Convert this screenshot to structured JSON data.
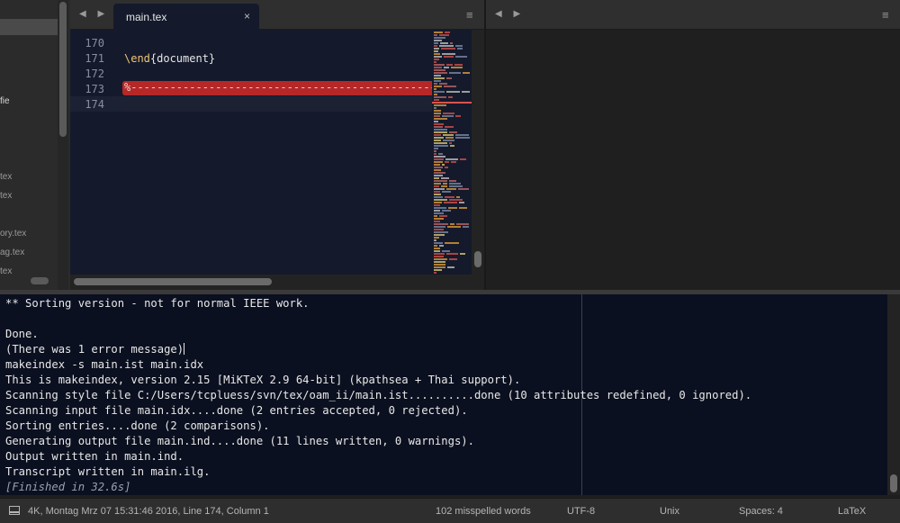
{
  "sidebar": {
    "items": [
      "fie",
      "tex",
      "tex",
      "ory.tex",
      "ag.tex",
      "tex"
    ]
  },
  "left_pane": {
    "tab": {
      "label": "main.tex",
      "close_glyph": "×"
    },
    "nav_arrows": "◀ ▶",
    "menu_glyph": "≡",
    "lines": [
      {
        "num": "170",
        "text": ""
      },
      {
        "num": "171",
        "keyword": "\\end",
        "text": "{document}"
      },
      {
        "num": "172",
        "text": ""
      },
      {
        "num": "173",
        "text": "%-------------------------------------------------"
      },
      {
        "num": "174",
        "text": ""
      }
    ]
  },
  "right_pane": {
    "nav_arrows": "◀ ▶",
    "menu_glyph": "≡"
  },
  "output": {
    "lines": [
      "** Sorting version - not for normal IEEE work.",
      "",
      "Done.",
      "(There was 1 error message)",
      "makeindex -s main.ist main.idx",
      "This is makeindex, version 2.15 [MiKTeX 2.9 64-bit] (kpathsea + Thai support).",
      "Scanning style file C:/Users/tcpluess/svn/tex/oam_ii/main.ist..........done (10 attributes redefined, 0 ignored).",
      "Scanning input file main.idx....done (2 entries accepted, 0 rejected).",
      "Sorting entries....done (2 comparisons).",
      "Generating output file main.ind....done (11 lines written, 0 warnings).",
      "Output written in main.ind.",
      "Transcript written in main.ilg."
    ],
    "finished": "[Finished in 32.6s]"
  },
  "status": {
    "position": "4K, Montag Mrz 07 15:31:46 2016, Line 174, Column 1",
    "spelling": "102 misspelled words",
    "encoding": "UTF-8",
    "line_endings": "Unix",
    "indentation": "Spaces: 4",
    "syntax": "LaTeX"
  },
  "colors": {
    "editor_bg": "#141a2b",
    "error_highlight": "#b62828",
    "keyword": "#f0c674"
  }
}
